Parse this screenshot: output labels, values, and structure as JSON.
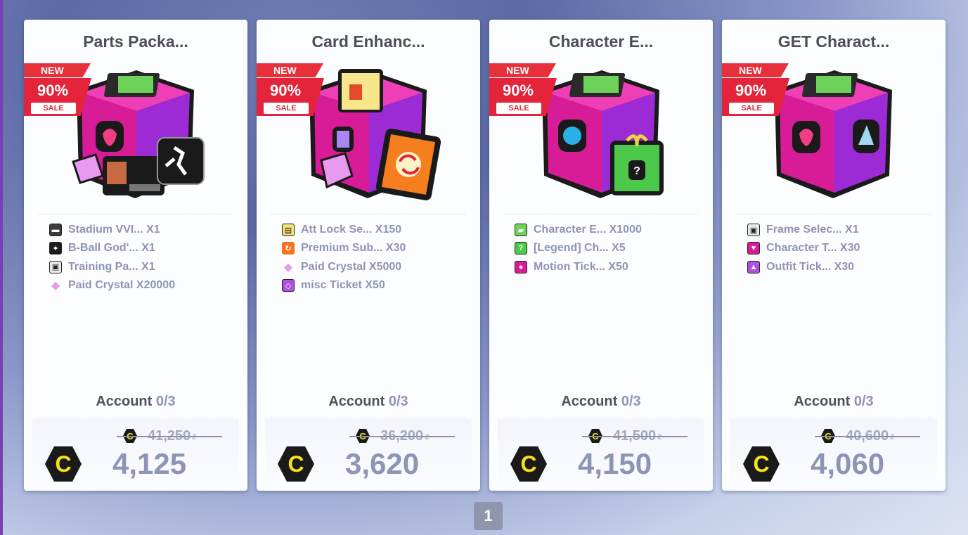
{
  "colors": {
    "accent_red": "#e3243a",
    "text_dark": "#4c4f5a",
    "text_muted": "#8d95b4",
    "coin_yellow": "#f5e21a"
  },
  "badge": {
    "new": "NEW",
    "percent": "90%",
    "sale": "SALE"
  },
  "cards": [
    {
      "title": "Parts Packa...",
      "items": [
        {
          "icon": "id-card-icon",
          "label": "Stadium VVI... X1"
        },
        {
          "icon": "jumpman-icon",
          "label": "B-Ball God'... X1"
        },
        {
          "icon": "chip-box-icon",
          "label": "Training Pa... X1"
        },
        {
          "icon": "crystal-icon",
          "label": "Paid Crystal X20000"
        }
      ],
      "account_label": "Account",
      "account_count": "0/3",
      "old_price": "41,250",
      "price": "4,125"
    },
    {
      "title": "Card Enhanc...",
      "items": [
        {
          "icon": "item-box-icon",
          "label": "Att Lock Se... X150"
        },
        {
          "icon": "card-icon",
          "label": "Premium Sub... X30"
        },
        {
          "icon": "crystal-icon",
          "label": "Paid Crystal X5000"
        },
        {
          "icon": "ticket-icon",
          "label": "misc Ticket X50"
        }
      ],
      "account_label": "Account",
      "account_count": "0/3",
      "old_price": "36,200",
      "price": "3,620"
    },
    {
      "title": "Character E...",
      "items": [
        {
          "icon": "chip-icon",
          "label": "Character E... X1000"
        },
        {
          "icon": "gift-icon",
          "label": "[Legend] Ch... X5"
        },
        {
          "icon": "motion-ticket-icon",
          "label": "Motion Tick... X50"
        }
      ],
      "account_label": "Account",
      "account_count": "0/3",
      "old_price": "41,500",
      "price": "4,150"
    },
    {
      "title": "GET Charact...",
      "items": [
        {
          "icon": "chip-box-icon",
          "label": "Frame Selec... X1"
        },
        {
          "icon": "heart-ticket-icon",
          "label": "Character T... X30"
        },
        {
          "icon": "outfit-ticket-icon",
          "label": "Outfit Tick... X30"
        }
      ],
      "account_label": "Account",
      "account_count": "0/3",
      "old_price": "40,600",
      "price": "4,060"
    }
  ],
  "pager": {
    "page": "1"
  }
}
